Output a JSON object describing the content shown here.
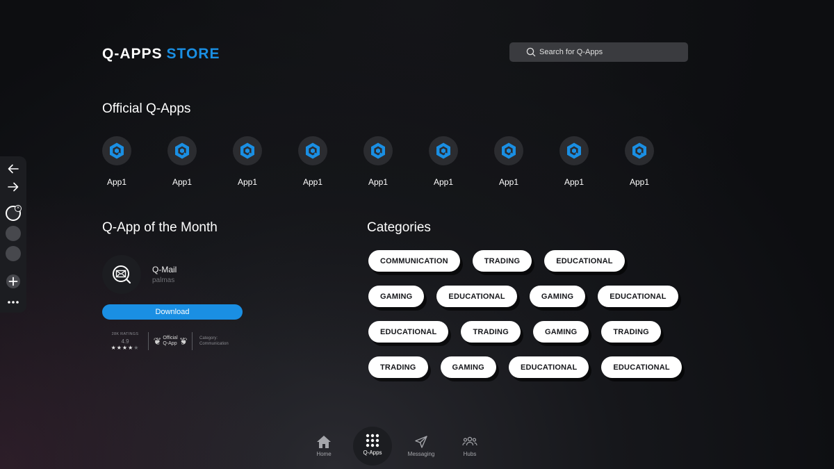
{
  "header": {
    "logo_part1": "Q-APPS",
    "logo_part2": "STORE",
    "search_placeholder": "Search for Q-Apps"
  },
  "colors": {
    "accent": "#1a8fe3",
    "background": "#0d0e11",
    "chip_bg": "#ffffff"
  },
  "official": {
    "title": "Official Q-Apps",
    "apps": [
      {
        "name": "App1"
      },
      {
        "name": "App1"
      },
      {
        "name": "App1"
      },
      {
        "name": "App1"
      },
      {
        "name": "App1"
      },
      {
        "name": "App1"
      },
      {
        "name": "App1"
      },
      {
        "name": "App1"
      },
      {
        "name": "App1"
      }
    ]
  },
  "month": {
    "title": "Q-App of the Month",
    "app_name": "Q-Mail",
    "developer": "palmas",
    "download_label": "Download",
    "ratings_label": "28K RATINGS",
    "rating_value": "4.9",
    "stars_filled": 4,
    "stars_total": 5,
    "official_line1": "Official",
    "official_line2": "Q-App",
    "category_label": "Category:",
    "category_value": "Communication"
  },
  "categories": {
    "title": "Categories",
    "rows": [
      [
        "COMMUNICATION",
        "TRADING",
        "EDUCATIONAL"
      ],
      [
        "GAMING",
        "EDUCATIONAL",
        "GAMING",
        "EDUCATIONAL"
      ],
      [
        "EDUCATIONAL",
        "TRADING",
        "GAMING",
        "TRADING"
      ],
      [
        "TRADING",
        "GAMING",
        "EDUCATIONAL",
        "EDUCATIONAL"
      ]
    ]
  },
  "nav": {
    "items": [
      {
        "label": "Home",
        "icon": "home-icon"
      },
      {
        "label": "Q-Apps",
        "icon": "grid-icon"
      },
      {
        "label": "Messaging",
        "icon": "send-icon"
      },
      {
        "label": "Hubs",
        "icon": "users-icon"
      }
    ],
    "active": "Q-Apps"
  },
  "sidebar": {
    "icons": [
      "back-arrow-icon",
      "forward-arrow-icon",
      "tab-circle",
      "tab-circle",
      "tab-circle",
      "plus-icon",
      "more-icon"
    ]
  }
}
